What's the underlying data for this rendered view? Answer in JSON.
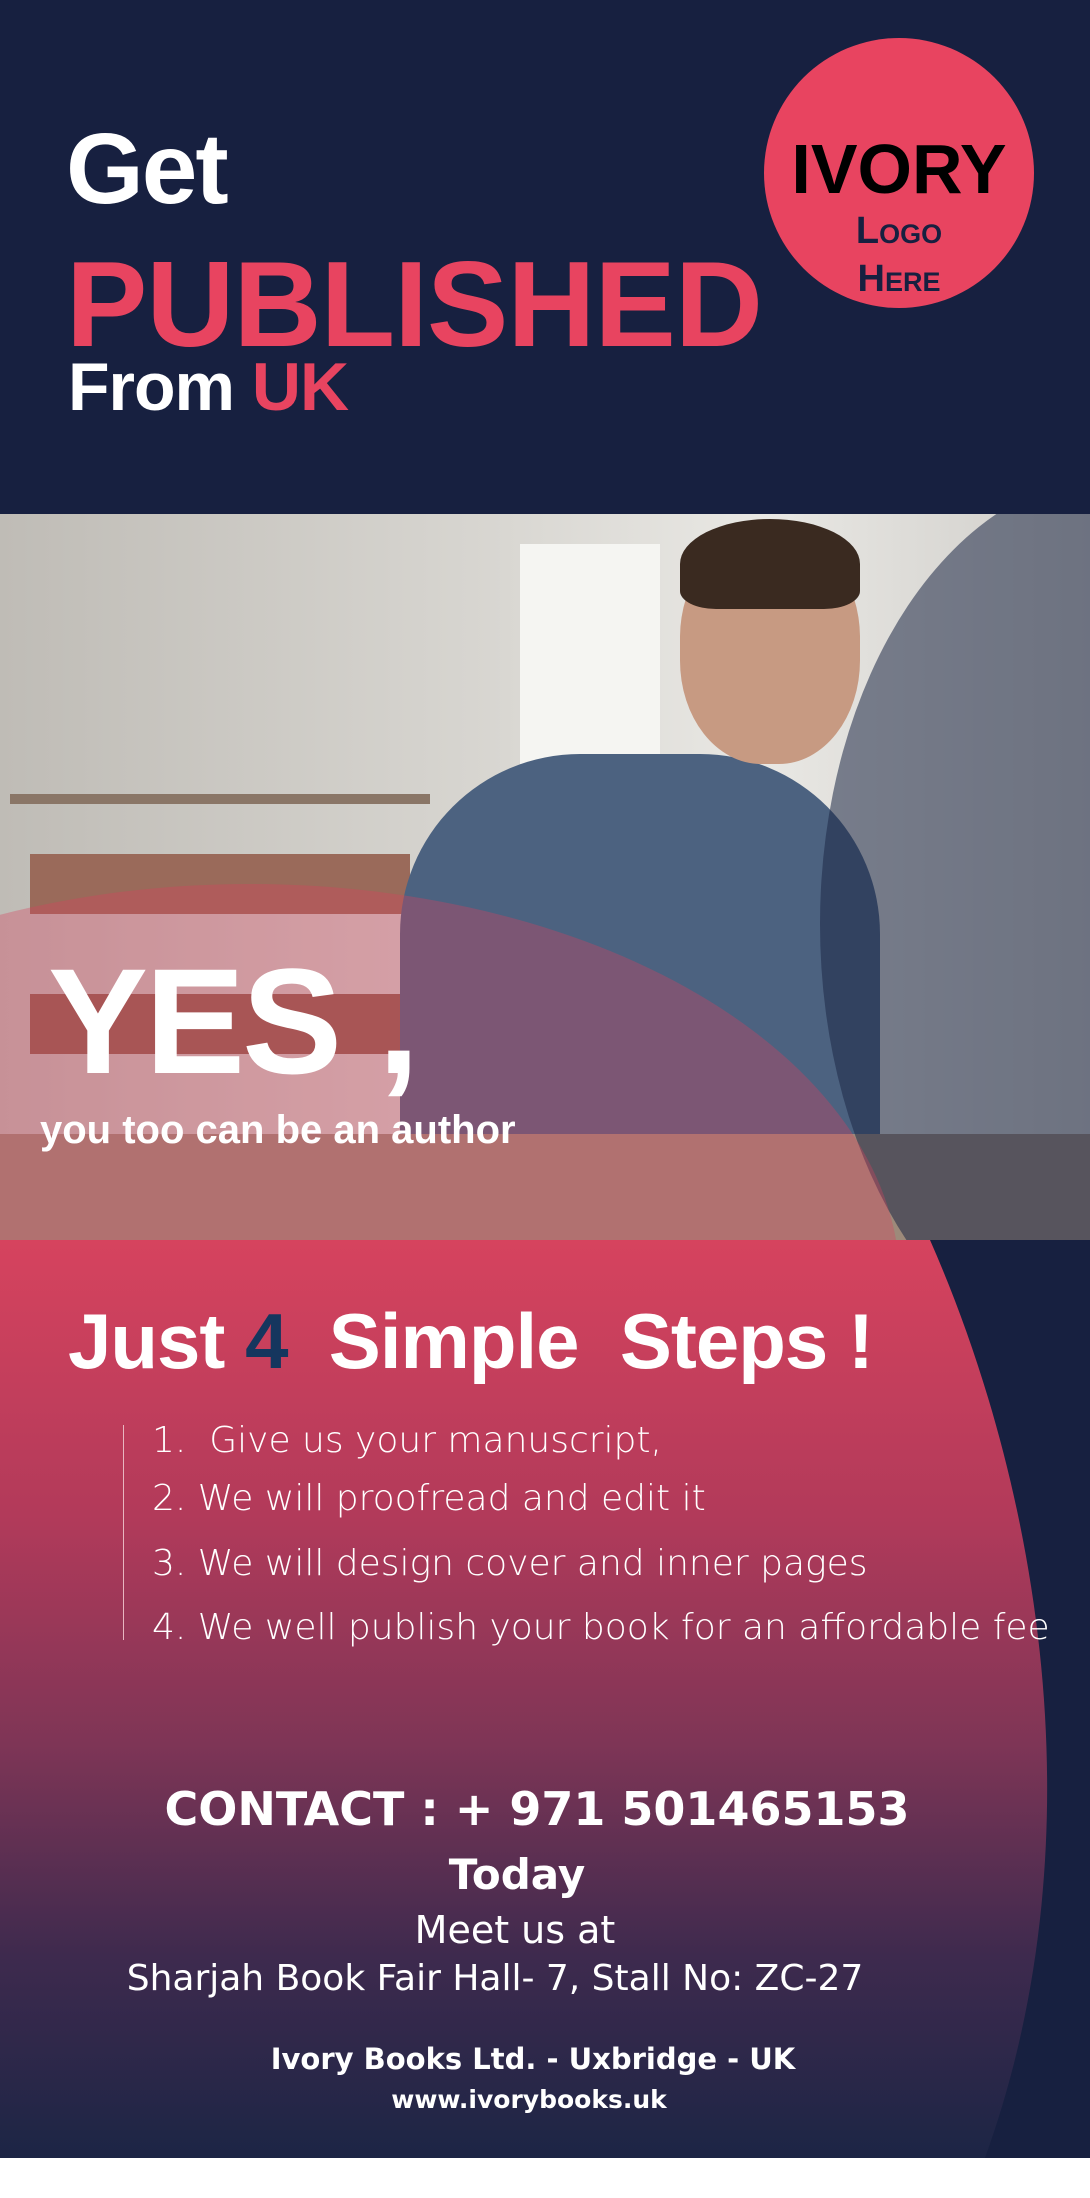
{
  "header": {
    "get": "Get",
    "published": "PUBLISHED",
    "from": "From",
    "uk": "UK"
  },
  "logo": {
    "brand": "IVORY",
    "line1": "Logo",
    "line2": "Here"
  },
  "hero": {
    "yes": "YES ,",
    "tagline": "you too can be an author"
  },
  "steps": {
    "just": "Just ",
    "number": "4",
    "rest": "  Simple  Steps !",
    "items": [
      "1.  Give us your manuscript,",
      "2. We will proofread and edit it",
      "3. We will design cover and inner pages",
      "4. We well publish your book for an affordable fee"
    ]
  },
  "contact": {
    "phone": "CONTACT : + 971 501465153",
    "today": "Today",
    "meet": "Meet us at",
    "venue": "Sharjah Book Fair Hall- 7, Stall No: ZC-27",
    "company": "Ivory Books Ltd. - Uxbridge - UK",
    "website": "www.ivorybooks.uk"
  },
  "colors": {
    "navy": "#172040",
    "pink": "#e84460",
    "step_number": "#15365e"
  }
}
